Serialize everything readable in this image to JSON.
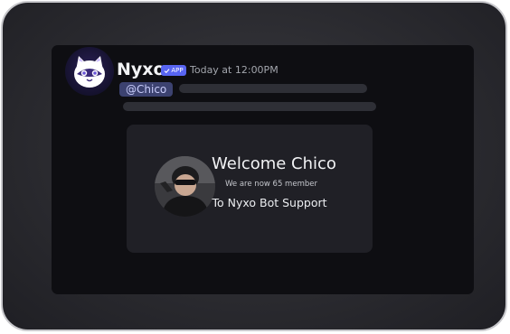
{
  "message": {
    "author": {
      "name": "Nyxo",
      "badge_label": "APP",
      "badge_icon": "check-icon",
      "avatar_icon": "cat-mascot-avatar",
      "badge_color": "#5865f2"
    },
    "timestamp": "Today at 12:00PM",
    "mention": "@Chico"
  },
  "welcome_card": {
    "title": "Welcome Chico",
    "member_line": "We are now 65 member",
    "server_line": "To Nyxo Bot Support",
    "avatar_icon": "user-photo-avatar"
  },
  "colors": {
    "background": "#0e0e12",
    "card": "#202026",
    "mention_bg": "#3c4270",
    "mention_text": "#c9cdfb"
  }
}
